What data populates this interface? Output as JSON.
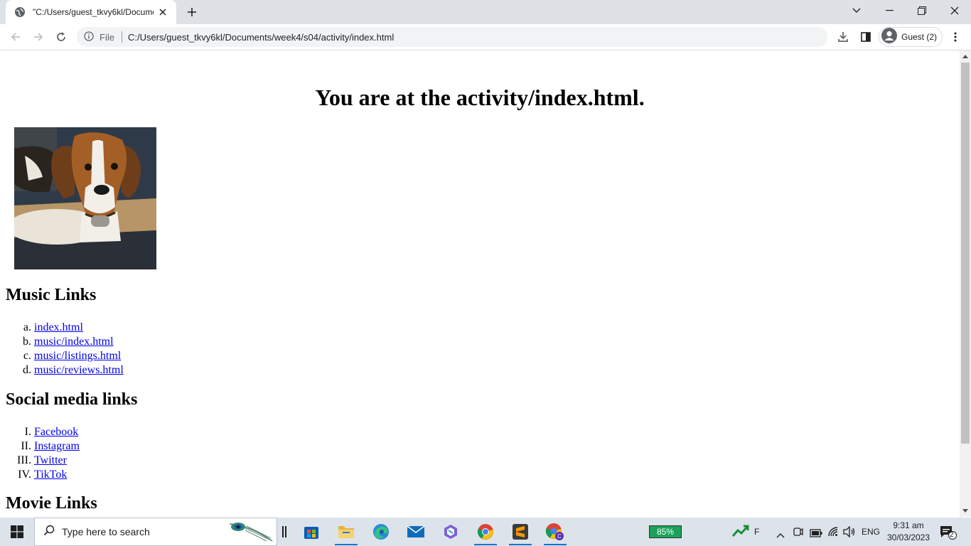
{
  "browser": {
    "tab_title": "\"C:/Users/guest_tkvy6kl/Docume",
    "url_scheme": "File",
    "url": "C:/Users/guest_tkvy6kl/Documents/week4/s04/activity/index.html",
    "profile_name": "Guest (2)"
  },
  "page": {
    "heading": "You are at the activity/index.html.",
    "music_heading": "Music Links",
    "music_links": [
      {
        "marker": "a.",
        "label": "index.html"
      },
      {
        "marker": "b.",
        "label": "music/index.html"
      },
      {
        "marker": "c.",
        "label": "music/listings.html"
      },
      {
        "marker": "d.",
        "label": "music/reviews.html"
      }
    ],
    "social_heading": "Social media links",
    "social_links": [
      {
        "marker": "I.",
        "label": "Facebook"
      },
      {
        "marker": "II.",
        "label": "Instagram"
      },
      {
        "marker": "III.",
        "label": "Twitter"
      },
      {
        "marker": "IV.",
        "label": "TikTok"
      }
    ],
    "movie_heading": "Movie Links"
  },
  "taskbar": {
    "search_placeholder": "Type here to search",
    "battery_percent": "85%",
    "tray_letter": "F",
    "language": "ENG",
    "time": "9:31 am",
    "date": "30/03/2023",
    "notification_count": "2"
  }
}
